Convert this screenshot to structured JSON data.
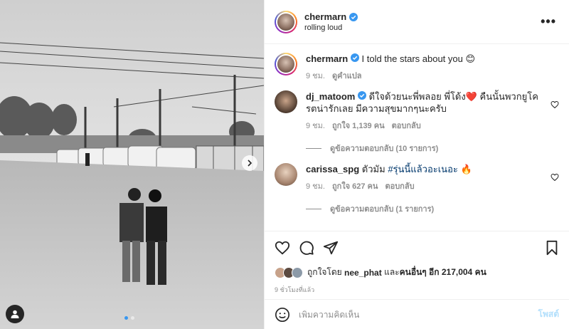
{
  "post": {
    "author": "chermarn",
    "location": "rolling loud",
    "carousel": {
      "current": 1,
      "total": 2
    }
  },
  "caption": {
    "author": "chermarn",
    "text": "I told the stars about you 😊",
    "time": "9 ชม.",
    "translate_label": "ดูคำแปล"
  },
  "comments": [
    {
      "author": "dj_matoom",
      "text": "ดีใจด้วยนะพี่พลอย พี่โด้ง❤️ คืนนั้นพวกยูโครตน่ารักเลย มีความสุขมากๆนะครับ",
      "time": "9 ชม.",
      "likes": "ถูกใจ 1,139 คน",
      "reply_label": "ตอบกลับ",
      "view_replies": "ดูข้อความตอบกลับ (10 รายการ)"
    },
    {
      "author": "carissa_spg",
      "text_prefix": "ตัวมัม",
      "hashtag": "#รุ่นนี้แล้วอะเนอะ",
      "text_suffix": "🔥",
      "time": "9 ชม.",
      "likes": "ถูกใจ 627 คน",
      "reply_label": "ตอบกลับ",
      "view_replies": "ดูข้อความตอบกลับ (1 รายการ)"
    }
  ],
  "likes": {
    "prefix": "ถูกใจโดย",
    "user": "nee_phat",
    "middle": "และ",
    "others": "คนอื่นๆ อีก 217,004 คน"
  },
  "timestamp": "9 ชั่วโมงที่แล้ว",
  "comment_box": {
    "placeholder": "เพิ่มความคิดเห็น",
    "post_label": "โพสต์"
  },
  "colors": {
    "verified": "#3897f0",
    "heart_red": "#ed4956",
    "link": "#00376b",
    "post_disabled": "#b2dffc"
  },
  "icons": {
    "like": "heart-icon",
    "comment": "comment-icon",
    "share": "share-icon",
    "save": "bookmark-icon",
    "emoji": "emoji-icon",
    "more": "more-options-icon",
    "next": "chevron-right-icon",
    "tag": "user-tag-icon"
  }
}
